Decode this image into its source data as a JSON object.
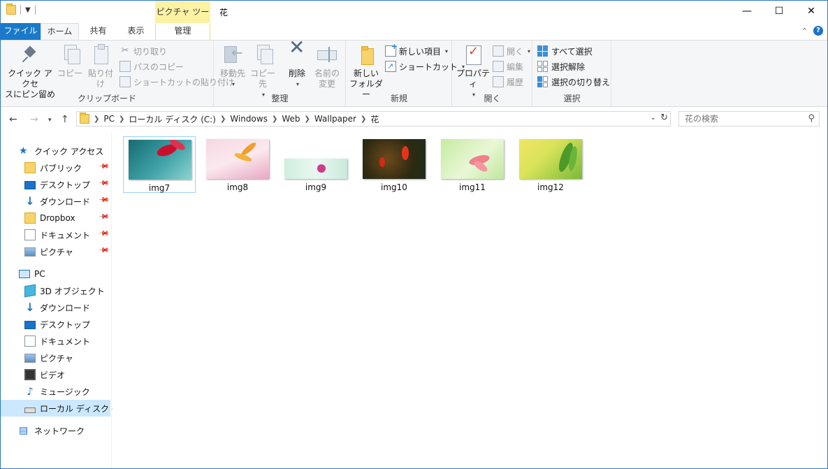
{
  "window": {
    "title": "花",
    "contextual_tab": "ピクチャ ツール",
    "controls": {
      "minimize": "—",
      "maximize": "☐",
      "close": "✕"
    }
  },
  "tabs": [
    "ファイル",
    "ホーム",
    "共有",
    "表示",
    "管理"
  ],
  "ribbon": {
    "clipboard": {
      "label": "クリップボード",
      "pin_line1": "クイック アクセ",
      "pin_line2": "スにピン留め",
      "copy": "コピー",
      "paste": "貼り付け",
      "cut": "切り取り",
      "copy_path": "パスのコピー",
      "paste_shortcut": "ショートカットの貼り付け"
    },
    "organize": {
      "label": "整理",
      "move_to": "移動先",
      "copy_to": "コピー先",
      "delete": "削除",
      "rename_line1": "名前の",
      "rename_line2": "変更"
    },
    "new": {
      "label": "新規",
      "new_folder_line1": "新しい",
      "new_folder_line2": "フォルダー",
      "new_item": "新しい項目",
      "shortcut": "ショートカット"
    },
    "open": {
      "label": "開く",
      "properties": "プロパティ",
      "open": "開く",
      "edit": "編集",
      "history": "履歴"
    },
    "select": {
      "label": "選択",
      "select_all": "すべて選択",
      "select_none": "選択解除",
      "invert": "選択の切り替え"
    }
  },
  "address": {
    "crumbs": [
      "PC",
      "ローカル ディスク (C:)",
      "Windows",
      "Web",
      "Wallpaper",
      "花"
    ],
    "search_placeholder": "花の検索"
  },
  "nav": {
    "quick_access": "クイック アクセス",
    "quick_items": [
      "パブリック",
      "デスクトップ",
      "ダウンロード",
      "Dropbox",
      "ドキュメント",
      "ピクチャ"
    ],
    "pc": "PC",
    "pc_items": [
      "3D オブジェクト",
      "ダウンロード",
      "デスクトップ",
      "ドキュメント",
      "ピクチャ",
      "ビデオ",
      "ミュージック",
      "ローカル ディスク (C:)"
    ],
    "network": "ネットワーク"
  },
  "files": [
    "img7",
    "img8",
    "img9",
    "img10",
    "img11",
    "img12"
  ],
  "colors": {
    "accent": "#1979ca",
    "contextual": "#fbf2a4",
    "selection": "#cce8ff"
  }
}
